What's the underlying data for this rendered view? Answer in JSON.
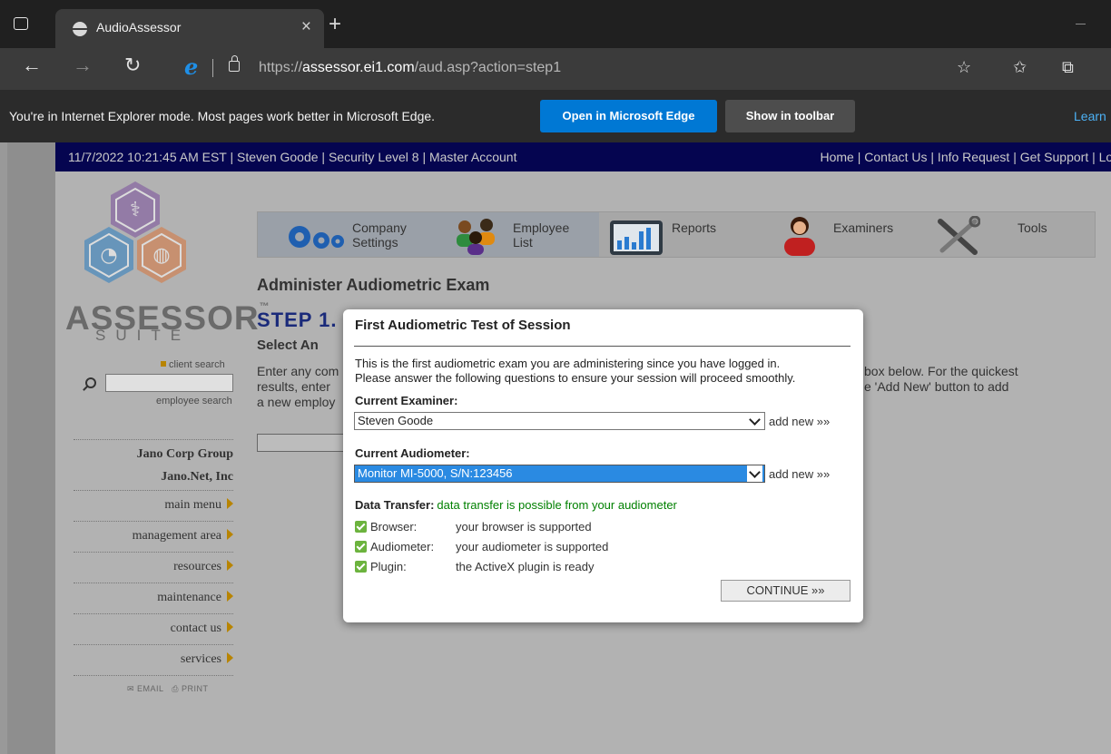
{
  "browser": {
    "tab_title": "AudioAssessor",
    "tab_close": "×",
    "new_tab": "+",
    "url_prefix": "https://",
    "url_host": "assessor.ei1.com",
    "url_path": "/aud.asp?action=step1"
  },
  "ie_mode_bar": {
    "message": "You're in Internet Explorer mode. Most pages work better in Microsoft Edge.",
    "open_button": "Open in Microsoft Edge",
    "show_button": "Show in toolbar",
    "learn": "Learn"
  },
  "topbar": {
    "left": "11/7/2022 10:21:45 AM EST | Steven Goode | Security Level 8 | Master Account",
    "right": "Home | Contact Us | Info Request | Get Support | Log"
  },
  "logo": {
    "name": "ASSESSOR",
    "tm": "™",
    "suite": "SUITE",
    "colors": {
      "purple": "#7b4f9d",
      "blue": "#2b7fc1",
      "orange": "#d9763b"
    }
  },
  "sidebar": {
    "client_search": "client search",
    "employee_search": "employee search",
    "company_group": "Jano Corp Group",
    "company": "Jano.Net, Inc",
    "items": [
      {
        "label": "main menu"
      },
      {
        "label": "management area"
      },
      {
        "label": "resources"
      },
      {
        "label": "maintenance"
      },
      {
        "label": "contact us"
      },
      {
        "label": "services"
      }
    ],
    "email": "EMAIL",
    "print": "PRINT"
  },
  "iconbar": {
    "items": [
      {
        "label1": "Company",
        "label2": "Settings",
        "icon": "gears-icon"
      },
      {
        "label1": "Employee",
        "label2": "List",
        "icon": "people-icon"
      },
      {
        "label1": "Reports",
        "label2": "",
        "icon": "chart-icon"
      },
      {
        "label1": "Examiners",
        "label2": "",
        "icon": "examiner-icon"
      },
      {
        "label1": "Tools",
        "label2": "",
        "icon": "tools-icon"
      }
    ]
  },
  "main": {
    "title": "Administer Audiometric Exam",
    "step": "STEP 1.",
    "select_heading": "Select An",
    "body_left": [
      "Enter any com",
      "results, enter",
      "a new employ"
    ],
    "body_right": [
      "box below. For the quickest",
      "e 'Add New' button to add"
    ]
  },
  "modal": {
    "title": "First Audiometric Test of Session",
    "intro_line1": "This is the first audiometric exam you are administering since you have logged in.",
    "intro_line2": "Please answer the following questions to ensure your session will proceed smoothly.",
    "examiner_label": "Current Examiner:",
    "examiner_value": "Steven Goode",
    "audiometer_label": "Current Audiometer:",
    "audiometer_value": "Monitor MI-5000, S/N:123456",
    "add_new": "add new »»",
    "transfer_label": "Data Transfer:",
    "transfer_status": "data transfer is possible from your audiometer",
    "checks": [
      {
        "key": "Browser:",
        "value": "your browser is supported"
      },
      {
        "key": "Audiometer:",
        "value": "your audiometer is supported"
      },
      {
        "key": "Plugin:",
        "value": "the ActiveX plugin is ready"
      }
    ],
    "continue": "CONTINUE »»"
  }
}
